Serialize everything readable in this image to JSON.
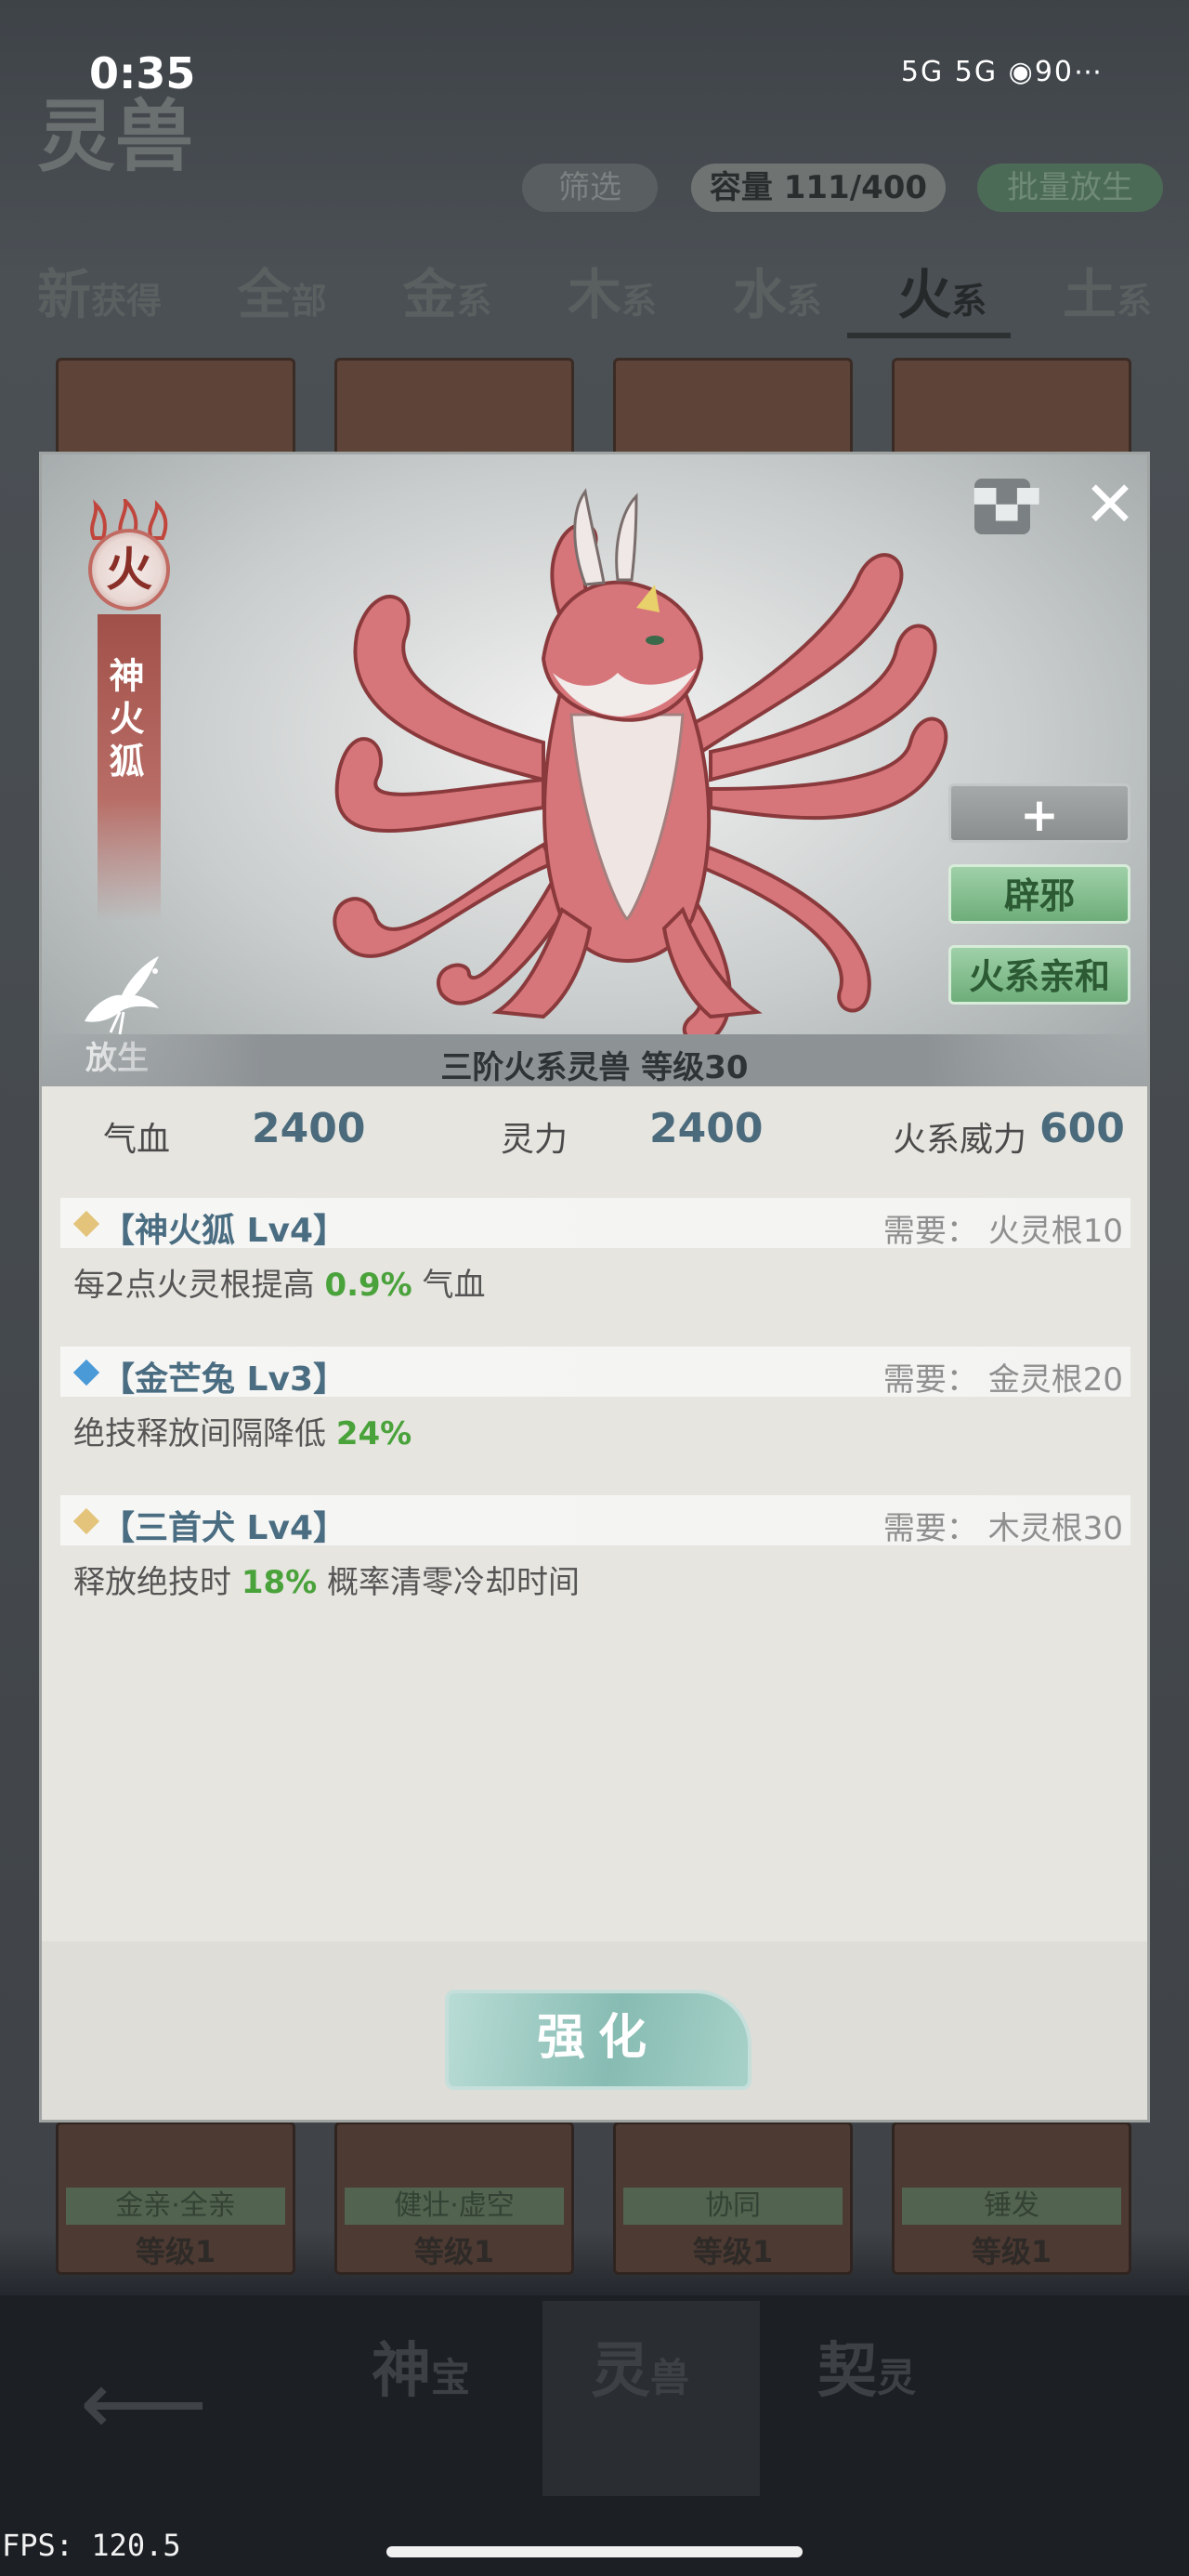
{
  "status_bar": {
    "time": "0:35",
    "network": "5G 5G",
    "battery": "90"
  },
  "background": {
    "logo": "灵兽",
    "filter_label": "筛选",
    "capacity_label": "容量 111/400",
    "batch_release_label": "批量放生",
    "tabs": [
      {
        "main": "新",
        "sub": "获得"
      },
      {
        "main": "全",
        "sub": "部"
      },
      {
        "main": "金",
        "sub": "系"
      },
      {
        "main": "木",
        "sub": "系"
      },
      {
        "main": "水",
        "sub": "系"
      },
      {
        "main": "火",
        "sub": "系"
      },
      {
        "main": "土",
        "sub": "系"
      }
    ],
    "bottom_cards": [
      {
        "label": "金亲·全亲",
        "level": "等级1"
      },
      {
        "label": "健壮·虚空",
        "level": "等级1"
      },
      {
        "label": "协同",
        "level": "等级1"
      },
      {
        "label": "锤发",
        "level": "等级1"
      }
    ],
    "nav": [
      {
        "main": "神",
        "sub": "宝"
      },
      {
        "main": "灵",
        "sub": "兽"
      },
      {
        "main": "契",
        "sub": "灵"
      }
    ],
    "fps": "FPS: 120.5"
  },
  "modal": {
    "element": "火",
    "beast_name": "神火狐",
    "release_label": "放生",
    "caption": "三阶火系灵兽   等级30",
    "side_buttons": {
      "plus": "+",
      "skill1": "辟邪",
      "skill2": "火系亲和"
    },
    "stats": [
      {
        "label": "气血",
        "value": "2400"
      },
      {
        "label": "灵力",
        "value": "2400"
      },
      {
        "label": "火系威力",
        "value": "600"
      }
    ],
    "skills": [
      {
        "name": "【神火狐 Lv4】",
        "req": "需要： 火灵根10",
        "desc_before": "每2点火灵根提高 ",
        "desc_highlight": "0.9%",
        "desc_after": " 气血",
        "diamond_color": "#e3c47a"
      },
      {
        "name": "【金芒兔 Lv3】",
        "req": "需要： 金灵根20",
        "desc_before": "绝技释放间隔降低 ",
        "desc_highlight": "24%",
        "desc_after": "",
        "diamond_color": "#4a9ad8"
      },
      {
        "name": "【三首犬 Lv4】",
        "req": "需要： 木灵根30",
        "desc_before": "释放绝技时 ",
        "desc_highlight": "18%",
        "desc_after": " 概率清零冷却时间",
        "diamond_color": "#e3c47a"
      }
    ],
    "upgrade_label": "强化"
  },
  "colors": {
    "accent_green": "#4aa23b",
    "value_blue": "#4b6b7c",
    "fire_red": "#c06a62"
  }
}
